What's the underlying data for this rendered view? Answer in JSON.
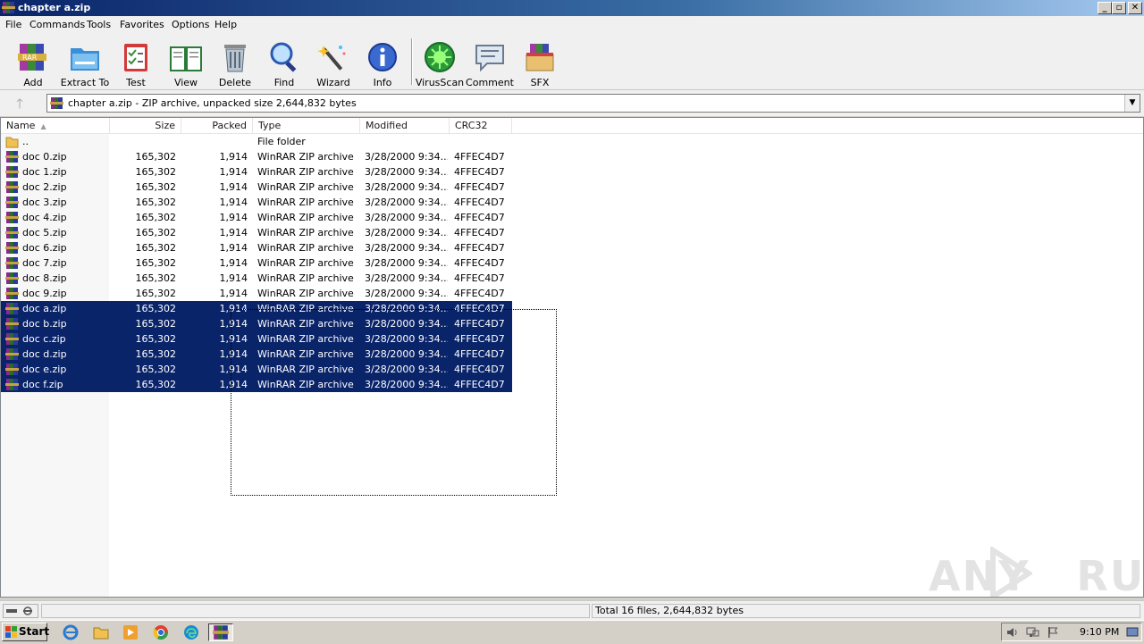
{
  "window": {
    "title": "chapter a.zip",
    "buttons": {
      "minimize": "_",
      "restore": "▫",
      "close": "✕"
    }
  },
  "menu": [
    "File",
    "Commands",
    "Tools",
    "Favorites",
    "Options",
    "Help"
  ],
  "toolbar": [
    {
      "label": "Add",
      "icon": "add-archive-icon"
    },
    {
      "label": "Extract To",
      "icon": "extract-folder-icon"
    },
    {
      "label": "Test",
      "icon": "test-clipboard-icon"
    },
    {
      "label": "View",
      "icon": "view-book-icon"
    },
    {
      "label": "Delete",
      "icon": "trash-icon"
    },
    {
      "label": "Find",
      "icon": "magnifier-icon"
    },
    {
      "label": "Wizard",
      "icon": "wand-icon"
    },
    {
      "label": "Info",
      "icon": "info-icon"
    },
    {
      "label": "VirusScan",
      "icon": "virus-scan-icon"
    },
    {
      "label": "Comment",
      "icon": "comment-icon"
    },
    {
      "label": "SFX",
      "icon": "sfx-box-icon"
    }
  ],
  "address": {
    "text": "chapter a.zip - ZIP archive, unpacked size 2,644,832 bytes",
    "up_label": "🡑"
  },
  "columns": [
    "Name",
    "Size",
    "Packed",
    "Type",
    "Modified",
    "CRC32"
  ],
  "files": [
    {
      "name": "..",
      "size": "",
      "packed": "",
      "type": "File folder",
      "modified": "",
      "crc": "",
      "selected": false,
      "folder": true
    },
    {
      "name": "doc 0.zip",
      "size": "165,302",
      "packed": "1,914",
      "type": "WinRAR ZIP archive",
      "modified": "3/28/2000 9:34...",
      "crc": "4FFEC4D7",
      "selected": false
    },
    {
      "name": "doc 1.zip",
      "size": "165,302",
      "packed": "1,914",
      "type": "WinRAR ZIP archive",
      "modified": "3/28/2000 9:34...",
      "crc": "4FFEC4D7",
      "selected": false
    },
    {
      "name": "doc 2.zip",
      "size": "165,302",
      "packed": "1,914",
      "type": "WinRAR ZIP archive",
      "modified": "3/28/2000 9:34...",
      "crc": "4FFEC4D7",
      "selected": false
    },
    {
      "name": "doc 3.zip",
      "size": "165,302",
      "packed": "1,914",
      "type": "WinRAR ZIP archive",
      "modified": "3/28/2000 9:34...",
      "crc": "4FFEC4D7",
      "selected": false
    },
    {
      "name": "doc 4.zip",
      "size": "165,302",
      "packed": "1,914",
      "type": "WinRAR ZIP archive",
      "modified": "3/28/2000 9:34...",
      "crc": "4FFEC4D7",
      "selected": false
    },
    {
      "name": "doc 5.zip",
      "size": "165,302",
      "packed": "1,914",
      "type": "WinRAR ZIP archive",
      "modified": "3/28/2000 9:34...",
      "crc": "4FFEC4D7",
      "selected": false
    },
    {
      "name": "doc 6.zip",
      "size": "165,302",
      "packed": "1,914",
      "type": "WinRAR ZIP archive",
      "modified": "3/28/2000 9:34...",
      "crc": "4FFEC4D7",
      "selected": false
    },
    {
      "name": "doc 7.zip",
      "size": "165,302",
      "packed": "1,914",
      "type": "WinRAR ZIP archive",
      "modified": "3/28/2000 9:34...",
      "crc": "4FFEC4D7",
      "selected": false
    },
    {
      "name": "doc 8.zip",
      "size": "165,302",
      "packed": "1,914",
      "type": "WinRAR ZIP archive",
      "modified": "3/28/2000 9:34...",
      "crc": "4FFEC4D7",
      "selected": false
    },
    {
      "name": "doc 9.zip",
      "size": "165,302",
      "packed": "1,914",
      "type": "WinRAR ZIP archive",
      "modified": "3/28/2000 9:34...",
      "crc": "4FFEC4D7",
      "selected": false
    },
    {
      "name": "doc a.zip",
      "size": "165,302",
      "packed": "1,914",
      "type": "WinRAR ZIP archive",
      "modified": "3/28/2000 9:34...",
      "crc": "4FFEC4D7",
      "selected": true
    },
    {
      "name": "doc b.zip",
      "size": "165,302",
      "packed": "1,914",
      "type": "WinRAR ZIP archive",
      "modified": "3/28/2000 9:34...",
      "crc": "4FFEC4D7",
      "selected": true
    },
    {
      "name": "doc c.zip",
      "size": "165,302",
      "packed": "1,914",
      "type": "WinRAR ZIP archive",
      "modified": "3/28/2000 9:34...",
      "crc": "4FFEC4D7",
      "selected": true
    },
    {
      "name": "doc d.zip",
      "size": "165,302",
      "packed": "1,914",
      "type": "WinRAR ZIP archive",
      "modified": "3/28/2000 9:34...",
      "crc": "4FFEC4D7",
      "selected": true
    },
    {
      "name": "doc e.zip",
      "size": "165,302",
      "packed": "1,914",
      "type": "WinRAR ZIP archive",
      "modified": "3/28/2000 9:34...",
      "crc": "4FFEC4D7",
      "selected": true
    },
    {
      "name": "doc f.zip",
      "size": "165,302",
      "packed": "1,914",
      "type": "WinRAR ZIP archive",
      "modified": "3/28/2000 9:34...",
      "crc": "4FFEC4D7",
      "selected": true
    }
  ],
  "status": {
    "right": "Total 16 files, 2,644,832 bytes"
  },
  "watermark": {
    "left": "ANY",
    "right": "RUN"
  },
  "taskbar": {
    "start": "Start",
    "apps": [
      "internet-explorer-icon",
      "file-explorer-icon",
      "media-player-icon",
      "chrome-icon",
      "edge-icon",
      "winrar-icon"
    ],
    "clock": "9:10 PM"
  },
  "colors": {
    "selection": "#0a246a",
    "titlebar": "#0a246a"
  }
}
